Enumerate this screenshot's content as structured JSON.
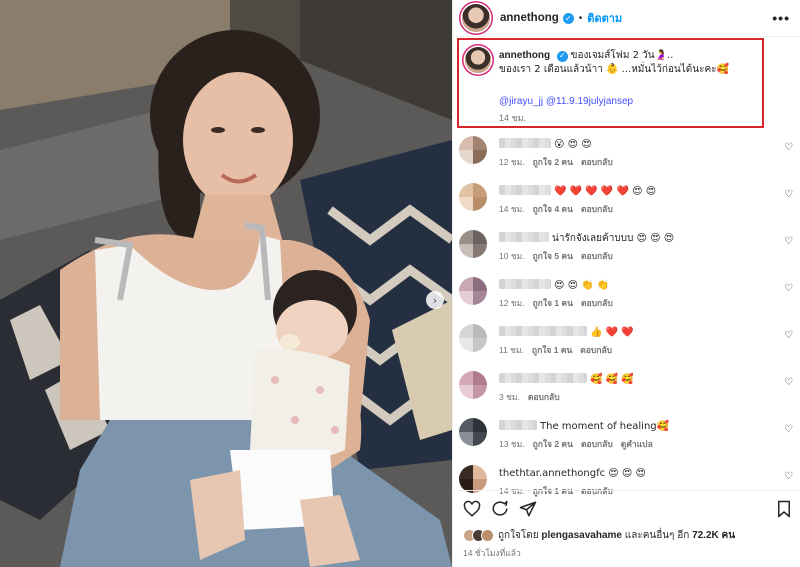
{
  "post": {
    "username": "annethong",
    "separator": "•",
    "follow_label": "ติดตาม",
    "more_label": "•••"
  },
  "caption": {
    "username": "annethong",
    "line1": "ของเจมส์โฟม 2 วัน🤰..",
    "line2": "ของเรา 2 เดือนแล้วน้าา 👶 ...หมั่นไว้ก่อนได้นะคะ🥰",
    "mention1": "@jirayu_jj",
    "mention2": "@11.9.19julyjansep",
    "time": "14 ชม."
  },
  "comments": [
    {
      "text": "😮 😍 😍",
      "time": "12 ชม.",
      "likes": "ถูกใจ 2 คน",
      "reply": "ตอบกลับ",
      "translate": "",
      "heart": "♡",
      "blur_width": 52,
      "colors": [
        "#d7bcb0",
        "#a1846f",
        "#e6d6cd",
        "#8a6b57"
      ]
    },
    {
      "text": "❤️ ❤️ ❤️ ❤️ ❤️ 😍 😍",
      "time": "14 ชม.",
      "likes": "ถูกใจ 4 คน",
      "reply": "ตอบกลับ",
      "translate": "",
      "heart": "♡",
      "blur_width": 52,
      "colors": [
        "#e0c2a2",
        "#c79e7c",
        "#eedac6",
        "#b88e6b"
      ]
    },
    {
      "text": "น่ารักจังเลยค้าบบบ 😍 😍 😍",
      "time": "10 ชม.",
      "likes": "ถูกใจ 5 คน",
      "reply": "ตอบกลับ",
      "translate": "",
      "heart": "♡",
      "blur_width": 50,
      "colors": [
        "#9b8f8a",
        "#6c625f",
        "#c8bdb8",
        "#857874"
      ]
    },
    {
      "text": "😍 😍 👏 👏",
      "time": "12 ชม.",
      "likes": "ถูกใจ 1 คน",
      "reply": "ตอบกลับ",
      "translate": "",
      "heart": "♡",
      "blur_width": 52,
      "colors": [
        "#c9a8b5",
        "#8c6d80",
        "#e3cdd6",
        "#a58597"
      ]
    },
    {
      "text": "👍 ❤️ ❤️",
      "time": "11 ชม.",
      "likes": "ถูกใจ 1 คน",
      "reply": "ตอบกลับ",
      "translate": "",
      "heart": "♡",
      "blur_width": 88,
      "colors": [
        "#d6d6d6",
        "#bbbbbb",
        "#e7e7e7",
        "#c6c6c6"
      ]
    },
    {
      "text": "🥰 🥰 🥰",
      "time": "3 ชม.",
      "likes": "",
      "reply": "ตอบกลับ",
      "translate": "",
      "heart": "♡",
      "blur_width": 88,
      "colors": [
        "#d3a9b6",
        "#b07b8d",
        "#e8ccd5",
        "#c495a6"
      ]
    },
    {
      "text": "The moment of healing🥰",
      "time": "13 ชม.",
      "likes": "ถูกใจ 2 คน",
      "reply": "ตอบกลับ",
      "translate": "ดูคำแปล",
      "heart": "♡",
      "blur_width": 38,
      "colors": [
        "#555a63",
        "#2f3339",
        "#8a8f98",
        "#43474f"
      ]
    },
    {
      "text": "thethtar.annethongfc 😍 😍 😍",
      "time": "14 ชม.",
      "likes": "ถูกใจ 1 คน",
      "reply": "ตอบกลับ",
      "translate": "",
      "heart": "♡",
      "blur_width": 0,
      "colors": [
        "#3a2a24",
        "#e0b89e",
        "#2a1d18",
        "#c99a7e"
      ]
    }
  ],
  "likes": {
    "prefix": "ถูกใจโดย",
    "user": "plengasavahame",
    "suffix": "และคนอื่นๆ อีก",
    "count": "72.2K",
    "unit": "คน"
  },
  "posted_ago": "14 ชั่วโมงที่แล้ว",
  "colors": {
    "accent": "#0095f6",
    "highlight": "#d8262c",
    "verified": "#1d9bf0"
  },
  "icons": [
    "heart-icon",
    "comment-icon",
    "share-icon",
    "bookmark-icon",
    "next-arrow-icon",
    "verified-icon"
  ]
}
